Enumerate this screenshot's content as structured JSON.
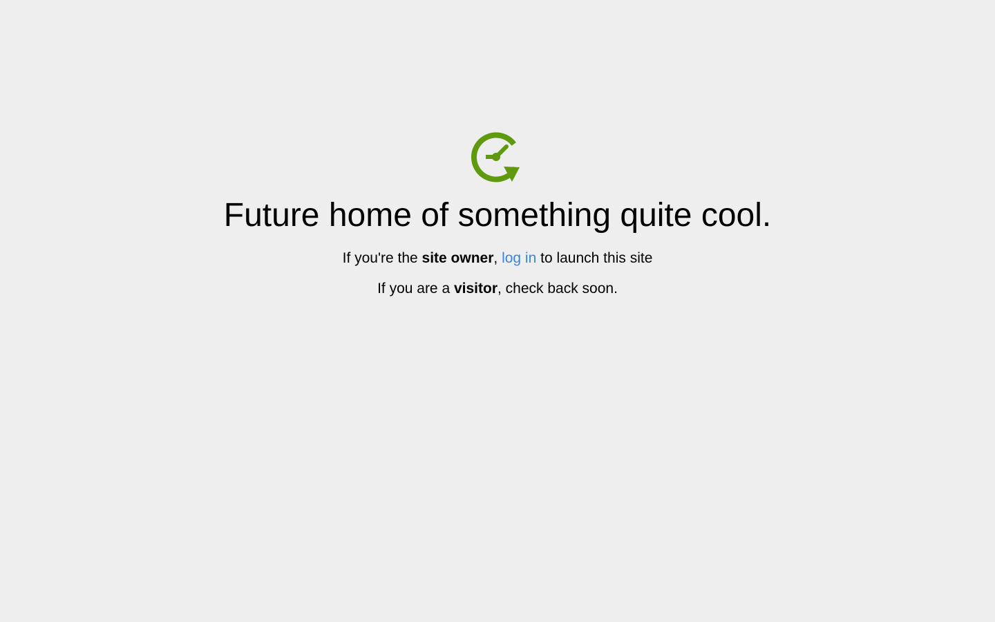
{
  "colors": {
    "background": "#eeeeee",
    "logo": "#5f9a0e",
    "link": "#3a86d6",
    "text": "#000000"
  },
  "logo": {
    "icon": "clock-refresh-icon"
  },
  "headline": "Future home of something quite cool.",
  "owner_line": {
    "prefix": "If you're the ",
    "bold": "site owner",
    "comma": ", ",
    "link": "log in",
    "suffix": " to launch this site"
  },
  "visitor_line": {
    "prefix": "If you are a ",
    "bold": "visitor",
    "suffix": ", check back soon."
  }
}
